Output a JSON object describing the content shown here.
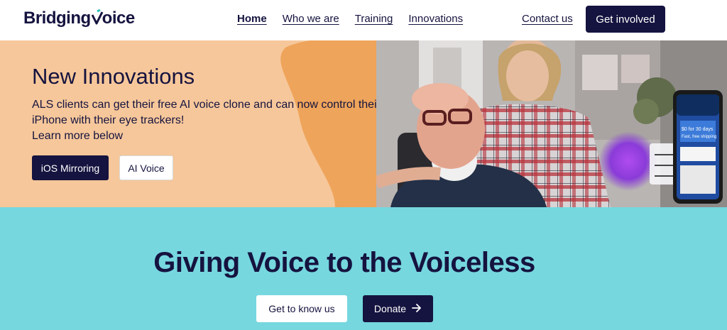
{
  "brand": {
    "name_part1": "Bridging",
    "name_part2": "oice",
    "accent": "#2ec4b6"
  },
  "nav": {
    "items": [
      {
        "label": "Home",
        "active": true
      },
      {
        "label": "Who we are",
        "active": false
      },
      {
        "label": "Training",
        "active": false
      },
      {
        "label": "Innovations",
        "active": false
      }
    ],
    "contact_label": "Contact us",
    "cta_label": "Get involved"
  },
  "hero": {
    "title": "New Innovations",
    "lines": [
      "ALS clients can get their free AI voice clone and can now control their",
      "iPhone with their eye trackers!",
      "Learn more below"
    ],
    "btn_primary": "iOS Mirroring",
    "btn_secondary": "AI Voice",
    "phone_promo_1": "$0 for 30 days",
    "phone_promo_2": "Fast, free shipping",
    "bg_color": "#f6c79a",
    "blob_color": "#eea45a"
  },
  "band": {
    "title": "Giving Voice to the Voiceless",
    "btn_know": "Get to know us",
    "btn_donate": "Donate",
    "bg_color": "#76d7df"
  }
}
